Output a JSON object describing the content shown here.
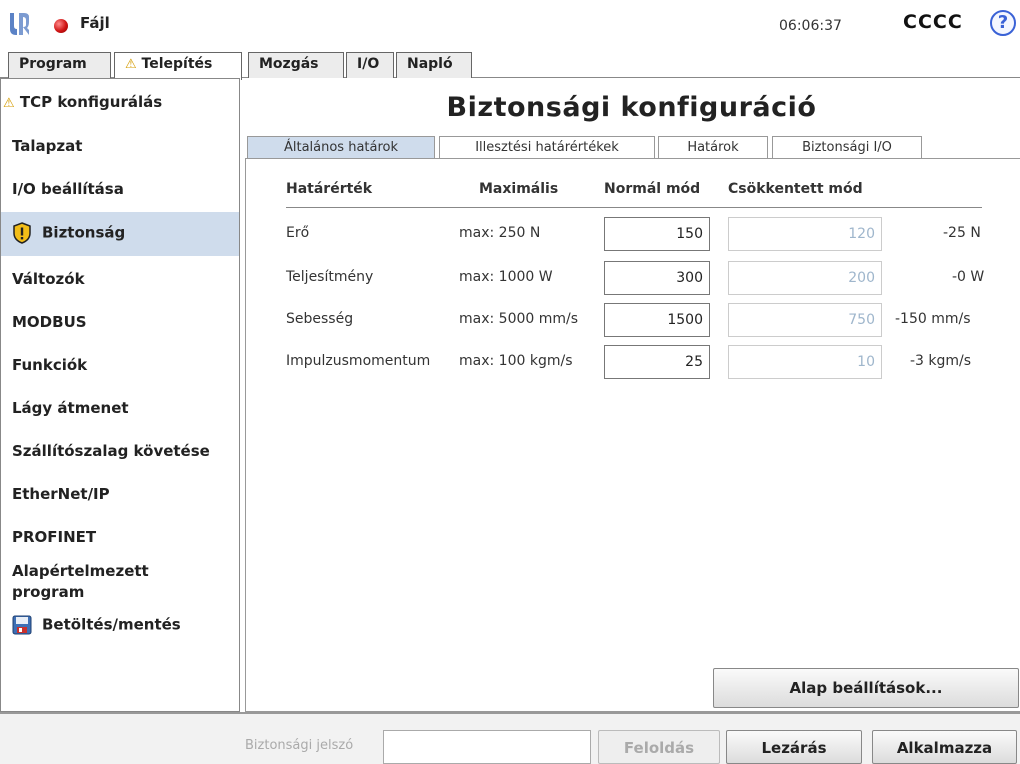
{
  "header": {
    "file_menu": "Fájl",
    "clock": "06:06:37",
    "robot_name": "CCCC",
    "help": "?"
  },
  "top_tabs": [
    {
      "label": "Program"
    },
    {
      "label": "Telepítés",
      "warning": "⚠"
    },
    {
      "label": "Mozgás"
    },
    {
      "label": "I/O"
    },
    {
      "label": "Napló"
    }
  ],
  "sidebar": {
    "items": [
      {
        "label": "TCP konfigurálás",
        "warning": "⚠"
      },
      {
        "label": "Talapzat"
      },
      {
        "label": "I/O beállítása"
      },
      {
        "label": "Biztonság"
      },
      {
        "label": "Változók"
      },
      {
        "label": "MODBUS"
      },
      {
        "label": "Funkciók"
      },
      {
        "label": "Lágy átmenet"
      },
      {
        "label": "Szállítószalag követése"
      },
      {
        "label": "EtherNet/IP"
      },
      {
        "label": "PROFINET"
      },
      {
        "label": "Alapértelmezett program"
      },
      {
        "label": "Betöltés/mentés"
      }
    ]
  },
  "main": {
    "title": "Biztonsági konfiguráció",
    "subtabs": [
      {
        "label": "Általános határok"
      },
      {
        "label": "Illesztési határértékek"
      },
      {
        "label": "Határok"
      },
      {
        "label": "Biztonsági I/O"
      }
    ],
    "table": {
      "headers": [
        "Határérték",
        "Maximális",
        "Normál mód",
        "Csökkentett mód"
      ],
      "rows": [
        {
          "name": "Erő",
          "max": "max: 250 N",
          "normal": "150",
          "reduced": "120",
          "diff": "-25 N"
        },
        {
          "name": "Teljesítmény",
          "max": "max: 1000 W",
          "normal": "300",
          "reduced": "200",
          "diff": "-0 W"
        },
        {
          "name": "Sebesség",
          "max": "max: 5000 mm/s",
          "normal": "1500",
          "reduced": "750",
          "diff": "-150 mm/s"
        },
        {
          "name": "Impulzusmomentum",
          "max": "max: 100 kgm/s",
          "normal": "25",
          "reduced": "10",
          "diff": "-3 kgm/s"
        }
      ]
    },
    "defaults_button": "Alap beállítások..."
  },
  "footer": {
    "password_label": "Biztonsági jelszó",
    "unlock": "Feloldás",
    "lock": "Lezárás",
    "apply": "Alkalmazza"
  }
}
